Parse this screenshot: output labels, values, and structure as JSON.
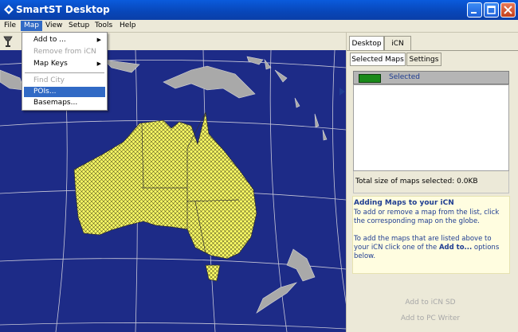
{
  "window": {
    "title": "SmartST Desktop"
  },
  "menubar": {
    "items": [
      "File",
      "Map",
      "View",
      "Setup",
      "Tools",
      "Help"
    ]
  },
  "map_menu": {
    "add_to": "Add to ...",
    "remove_from_icn": "Remove from iCN",
    "map_keys": "Map Keys",
    "find_city": "Find City",
    "pois": "POIs...",
    "basemaps": "Basemaps..."
  },
  "side_panel": {
    "tabs": [
      "Desktop",
      "iCN"
    ],
    "subtabs": [
      "Selected Maps",
      "Settings"
    ],
    "selected_label": "Selected",
    "total_size": "Total size of maps selected: 0.0KB",
    "help_title": "Adding Maps to your iCN",
    "help_text_1": "To add or remove a map from the list, click the corresponding map on the globe.",
    "help_text_2_prefix": "To add the maps that are listed above to your iCN click one of the ",
    "help_text_2_bold": "Add to...",
    "help_text_2_suffix": " options below.",
    "button_add_icn_sd": "Add to iCN SD",
    "button_add_pc_writer": "Add to PC Writer"
  },
  "colors": {
    "ocean": "#1d2b87",
    "selected_country": "#ffff66",
    "land_gray": "#a9a9a9",
    "menu_highlight": "#316ac5",
    "selected_swatch": "#1a8a1a"
  },
  "icons": {
    "app": "app-diamond-icon",
    "toolbar": "lamp-icon",
    "minimize": "minimize-icon",
    "maximize": "maximize-icon",
    "close": "close-icon",
    "submenu": "submenu-arrow-icon"
  }
}
